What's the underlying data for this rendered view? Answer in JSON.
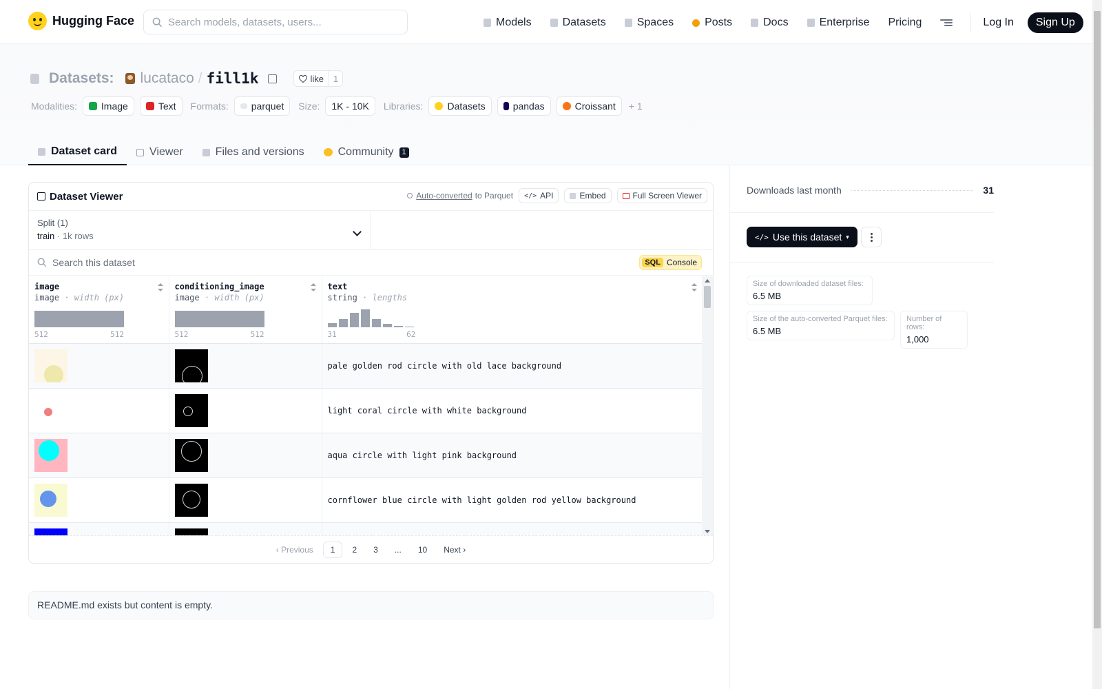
{
  "header": {
    "brand": "Hugging Face",
    "search_placeholder": "Search models, datasets, users...",
    "nav": [
      "Models",
      "Datasets",
      "Spaces",
      "Posts",
      "Docs",
      "Enterprise",
      "Pricing"
    ],
    "login": "Log In",
    "signup": "Sign Up"
  },
  "repo": {
    "prefix": "Datasets:",
    "owner": "lucataco",
    "slash": "/",
    "name": "fill1k",
    "like_label": "like",
    "like_count": "1"
  },
  "tags": {
    "modalities_label": "Modalities:",
    "modalities": [
      "Image",
      "Text"
    ],
    "formats_label": "Formats:",
    "formats": [
      "parquet"
    ],
    "size_label": "Size:",
    "size": "1K - 10K",
    "libraries_label": "Libraries:",
    "libraries": [
      "Datasets",
      "pandas",
      "Croissant"
    ],
    "more": "+ 1"
  },
  "tabs": [
    {
      "label": "Dataset card",
      "active": true
    },
    {
      "label": "Viewer"
    },
    {
      "label": "Files and versions"
    },
    {
      "label": "Community",
      "badge": "1"
    }
  ],
  "viewer": {
    "title": "Dataset Viewer",
    "auto_converted": "Auto-converted",
    "to_parquet": "to Parquet",
    "api": "API",
    "embed": "Embed",
    "fullscreen": "Full Screen Viewer",
    "split_label": "Split (1)",
    "split_name": "train",
    "split_sep": "·",
    "split_rows": "1k rows",
    "search_placeholder": "Search this dataset",
    "sql": "SQL",
    "console": "Console",
    "columns": [
      {
        "name": "image",
        "type": "image",
        "stat": "· width (px)",
        "min": "512",
        "max": "512"
      },
      {
        "name": "conditioning_image",
        "type": "image",
        "stat": "· width (px)",
        "min": "512",
        "max": "512"
      },
      {
        "name": "text",
        "type": "string",
        "stat": "· lengths",
        "min": "31",
        "max": "62"
      }
    ],
    "length_hist": [
      0.22,
      0.48,
      0.82,
      1.0,
      0.48,
      0.2,
      0.08,
      0.04
    ],
    "rows": [
      {
        "text": "pale golden rod circle with old lace background",
        "bg": "#fdf5e6",
        "fg": "#eee8aa"
      },
      {
        "text": "light coral circle with white background",
        "bg": "#ffffff",
        "fg": "#f08080"
      },
      {
        "text": "aqua circle with light pink background",
        "bg": "#ffb6c1",
        "fg": "#00ffff"
      },
      {
        "text": "cornflower blue circle with light golden rod yellow background",
        "bg": "#fafad2",
        "fg": "#6495ed"
      },
      {
        "text": "",
        "bg": "#0000ff",
        "fg": "#8a9bb0"
      }
    ],
    "pager": {
      "prev": "Previous",
      "pages": [
        "1",
        "2",
        "3",
        "...",
        "10"
      ],
      "next": "Next"
    }
  },
  "readme": "README.md exists but content is empty.",
  "sidebar": {
    "downloads_label": "Downloads last month",
    "downloads": "31",
    "use_button": "Use this dataset",
    "stats": [
      {
        "label": "Size of downloaded dataset files:",
        "value": "6.5 MB"
      },
      {
        "label": "Size of the auto-converted Parquet files:",
        "value": "6.5 MB"
      },
      {
        "label": "Number of rows:",
        "value": "1,000"
      }
    ]
  },
  "colors": {
    "brand_yellow": "#ffd21e",
    "dark": "#0b0f19",
    "sql_badge": "#fcd34d"
  }
}
